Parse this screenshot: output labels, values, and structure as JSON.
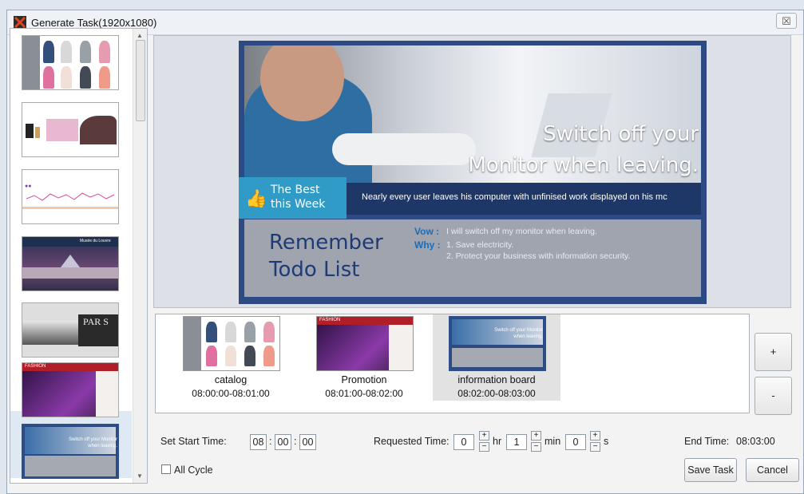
{
  "window": {
    "title": "Generate Task(1920x1080)",
    "close_glyph": "☒"
  },
  "thumbnails": [
    {
      "name": "catalog-thumb"
    },
    {
      "name": "product-thumb"
    },
    {
      "name": "chart-thumb"
    },
    {
      "name": "louvre-thumb",
      "text": "Musée du Louvre"
    },
    {
      "name": "paris-thumb",
      "text": "PAR S"
    },
    {
      "name": "fashion-thumb",
      "text": "FASHION"
    },
    {
      "name": "info-board-thumb",
      "text": "Switch off your Monitor when leaving."
    }
  ],
  "preview": {
    "headline_1": "Switch off your",
    "headline_2": "Monitor when leaving.",
    "badge_1": "The Best",
    "badge_2": "this Week",
    "band": "Nearly every user leaves his computer with unfinised work displayed on his mc",
    "remember_1": "Remember",
    "remember_2": "Todo List",
    "vow_label": "Vow :",
    "vow_text": "I will switch off my monitor when leaving.",
    "why_label": "Why :",
    "why_1": "1. Save electricity.",
    "why_2": "2. Protect your business with information security."
  },
  "timeline": [
    {
      "name": "catalog",
      "time": "08:00:00-08:01:00"
    },
    {
      "name": "Promotion",
      "time": "08:01:00-08:02:00"
    },
    {
      "name": "information board",
      "time": "08:02:00-08:03:00"
    }
  ],
  "side_buttons": {
    "add": "+",
    "remove": "-"
  },
  "start_time": {
    "label": "Set Start Time:",
    "hh": "08",
    "mm": "00",
    "ss": "00",
    "sep": ":"
  },
  "requested_time": {
    "label": "Requested Time:",
    "hr_value": "0",
    "hr_unit": "hr",
    "min_value": "1",
    "min_unit": "min",
    "s_value": "0",
    "s_unit": "s",
    "plus": "+",
    "minus": "−"
  },
  "end_time": {
    "label": "End Time:",
    "value": "08:03:00"
  },
  "all_cycle": {
    "label": "All Cycle"
  },
  "buttons": {
    "save": "Save Task",
    "cancel": "Cancel"
  }
}
